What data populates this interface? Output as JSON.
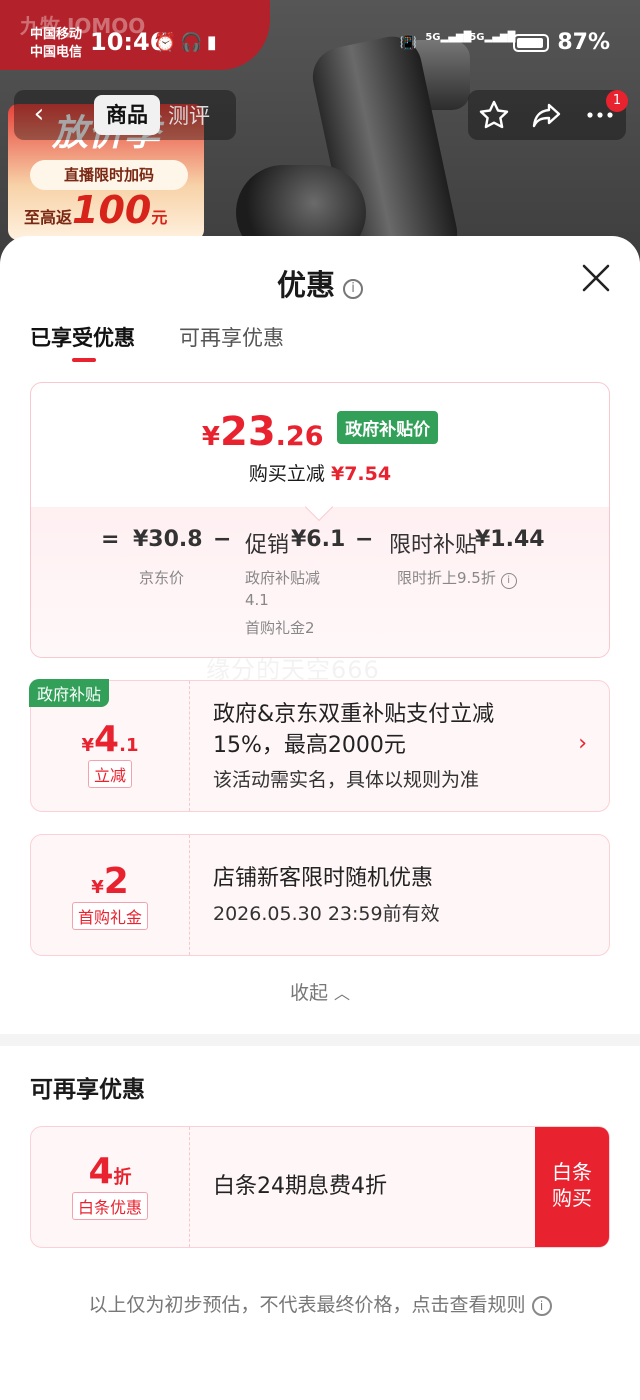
{
  "status_bar": {
    "carrier_1": "中国移动",
    "carrier_2": "中国电信",
    "time": "10:46",
    "network_1": "5G",
    "network_2": "5G",
    "battery": "87%"
  },
  "background": {
    "promo_big": "放价季",
    "promo_pill": "直播限时加码",
    "promo_prefix": "至高返",
    "promo_amount": "100",
    "promo_unit": "元",
    "badge_faint": "九牧 JOMOO"
  },
  "nav": {
    "tabs": [
      "商品",
      "测评"
    ],
    "notification_count": "1"
  },
  "sheet": {
    "title": "优惠",
    "tabs": [
      "已享受优惠",
      "可再享优惠"
    ],
    "summary": {
      "currency": "¥",
      "price_int": "23",
      "price_dec": ".26",
      "gov_tag": "政府补贴价",
      "reduce_label": "购买立减",
      "reduce_value": "¥7.54",
      "eq": "=",
      "jd_price": "¥30.8",
      "minus": "−",
      "promo_label": "促销",
      "promo_value": "¥6.1",
      "limited_label": "限时补贴",
      "limited_value": "¥1.44",
      "jd_price_caption": "京东价",
      "promo_caption_1": "政府补贴减",
      "promo_caption_1b": "4.1",
      "promo_caption_2": "首购礼金2",
      "limited_caption": "限时折上9.5折"
    },
    "watermark": "缘分的天空666",
    "coupons": [
      {
        "corner_tag": "政府补贴",
        "currency": "¥",
        "amount_int": "4",
        "amount_dec": ".1",
        "label": "立减",
        "desc_line1": "政府&京东双重补贴支付立减",
        "desc_line2": "15%，最高2000元",
        "desc_line3": "该活动需实名，具体以规则为准"
      },
      {
        "currency": "¥",
        "amount_int": "2",
        "label": "首购礼金",
        "desc_line1": "店铺新客限时随机优惠",
        "desc_line2": "2026.05.30 23:59前有效"
      }
    ],
    "collapse_label": "收起",
    "more_section_title": "可再享优惠",
    "baitiao": {
      "amount": "4",
      "unit": "折",
      "label": "白条优惠",
      "desc": "白条24期息费4折",
      "button_line1": "白条",
      "button_line2": "购买"
    },
    "footer_note": "以上仅为初步预估，不代表最终价格，点击查看规则"
  },
  "colors": {
    "accent_red": "#e8232f",
    "gov_green": "#33a05a"
  }
}
